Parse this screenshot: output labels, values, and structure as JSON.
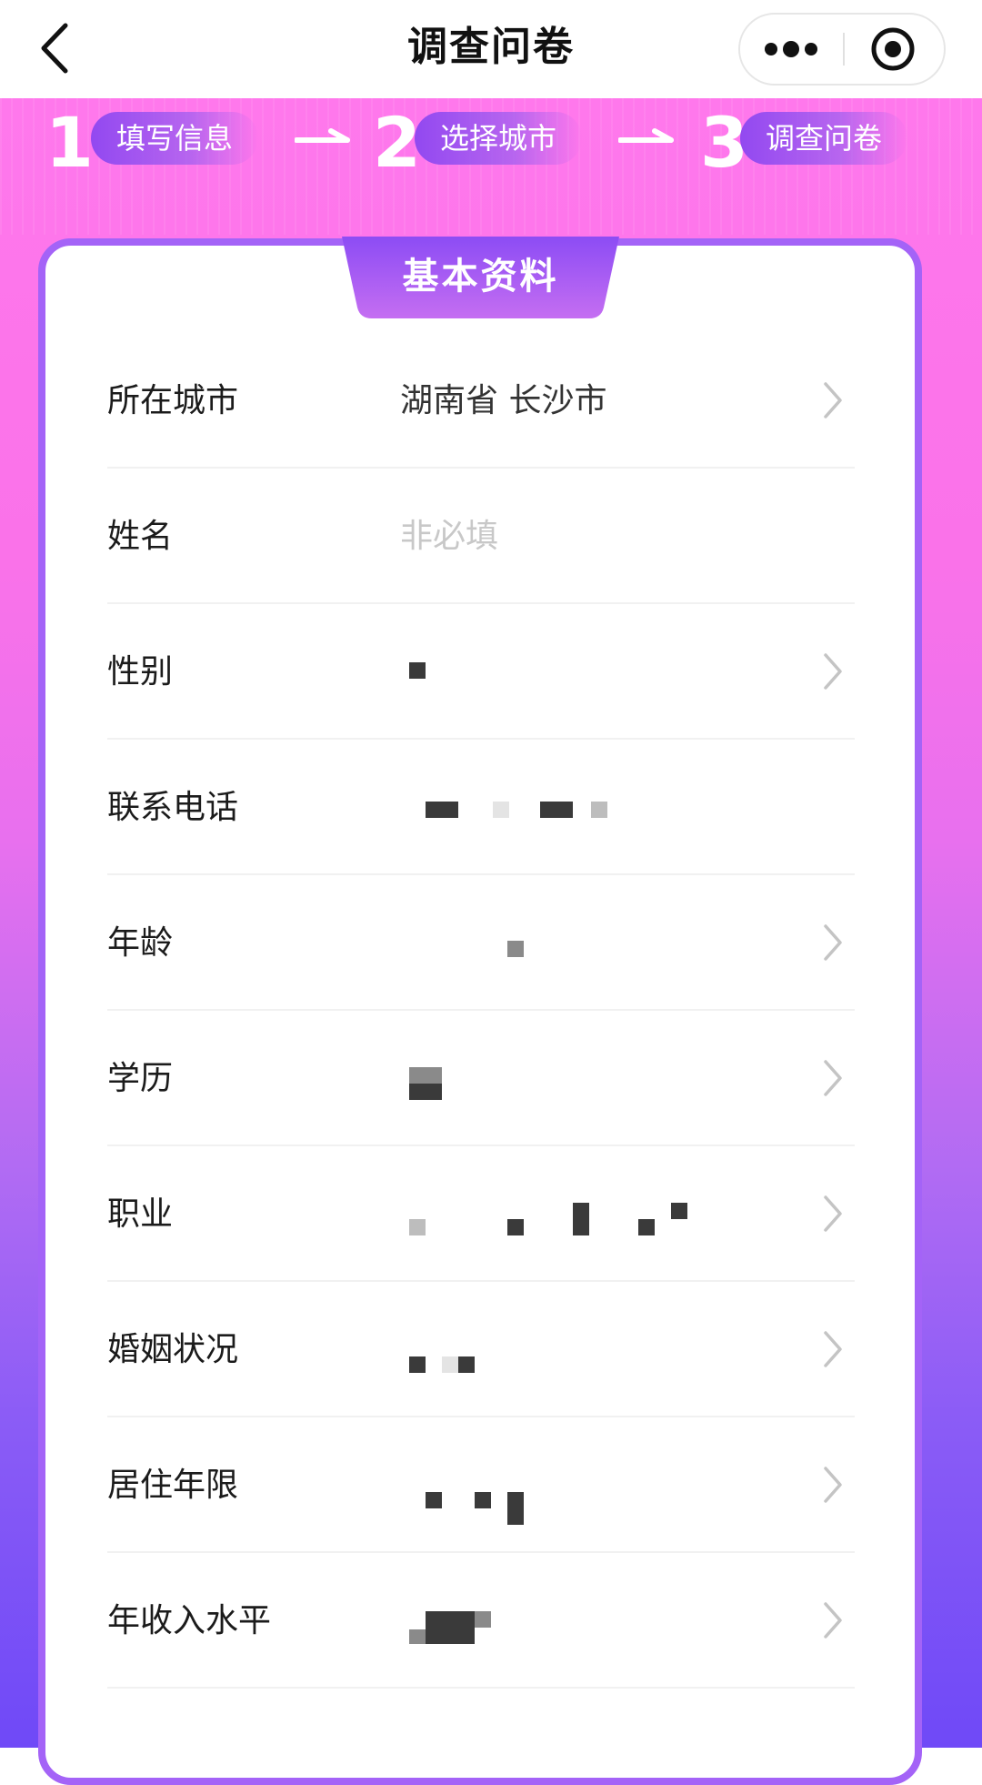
{
  "nav": {
    "title": "调查问卷",
    "back_icon": "chevron-left-icon",
    "more_icon": "more-dots-icon",
    "close_icon": "target-circle-icon"
  },
  "steps": [
    {
      "number": "1",
      "label": "填写信息"
    },
    {
      "number": "2",
      "label": "选择城市"
    },
    {
      "number": "3",
      "label": "调查问卷"
    }
  ],
  "card": {
    "title": "基本资料"
  },
  "form": {
    "rows": [
      {
        "label": "所在城市",
        "value": "湖南省 长沙市",
        "has_chevron": true
      },
      {
        "label": "姓名",
        "placeholder": "非必填",
        "has_chevron": false
      },
      {
        "label": "性别",
        "value": "",
        "has_chevron": true
      },
      {
        "label": "联系电话",
        "value": "",
        "has_chevron": false
      },
      {
        "label": "年龄",
        "value": "",
        "has_chevron": true
      },
      {
        "label": "学历",
        "value": "",
        "has_chevron": true
      },
      {
        "label": "职业",
        "value": "",
        "has_chevron": true
      },
      {
        "label": "婚姻状况",
        "value": "",
        "has_chevron": true
      },
      {
        "label": "居住年限",
        "value": "",
        "has_chevron": true
      },
      {
        "label": "年收入水平",
        "value": "",
        "has_chevron": true
      }
    ]
  },
  "colors": {
    "gradient_top": "#ff78ec",
    "gradient_bottom": "#6f49f7",
    "card_border": "#a463f7",
    "pill": "#8c46f0"
  }
}
